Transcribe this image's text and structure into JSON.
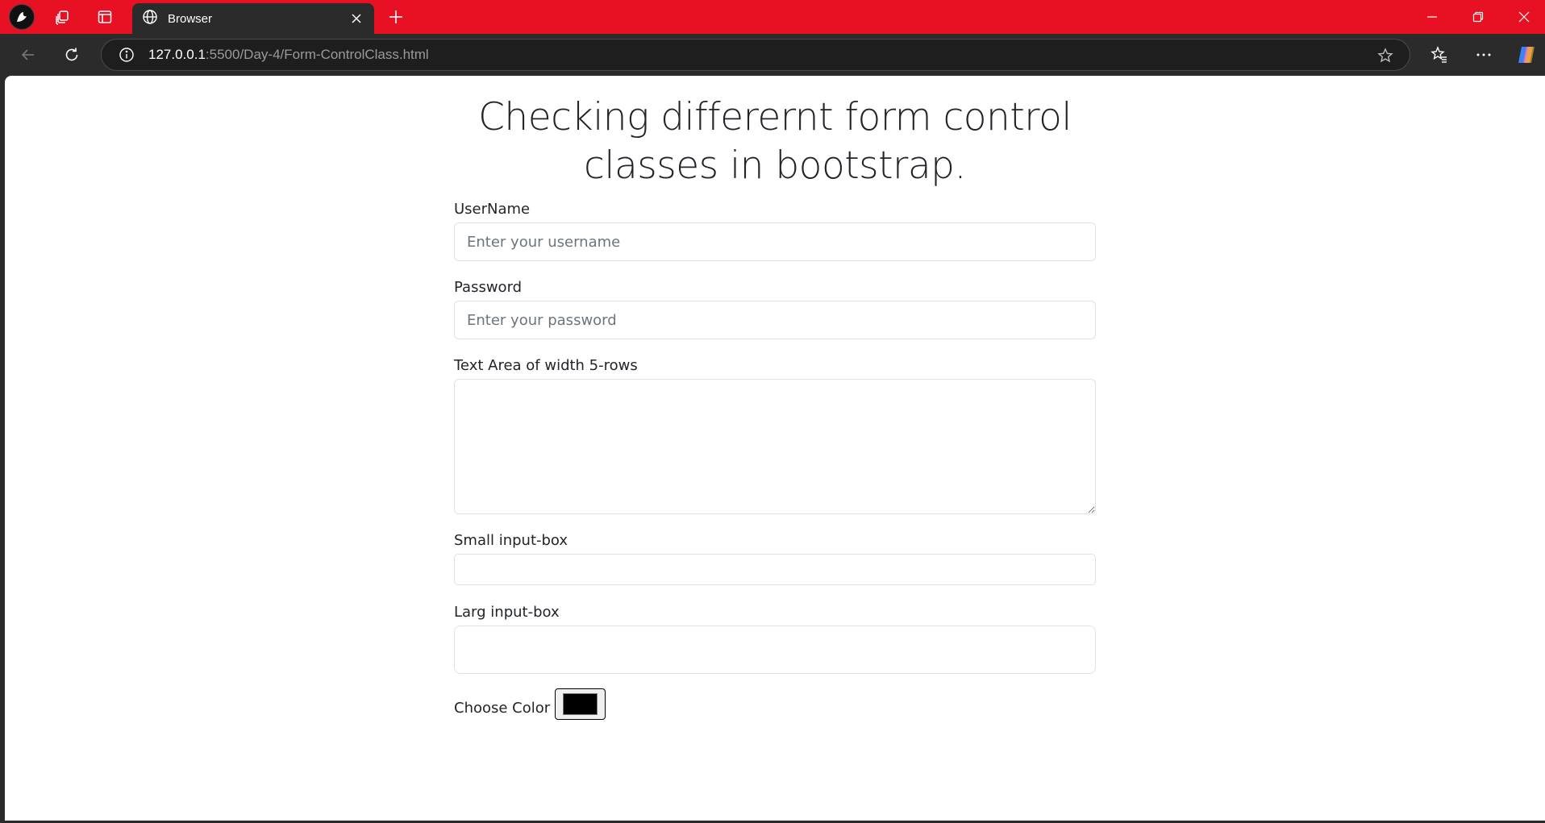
{
  "browser": {
    "tab_title": "Browser",
    "url_host": "127.0.0.1",
    "url_rest": ":5500/Day-4/Form-ControlClass.html"
  },
  "page": {
    "heading": "Checking differernt form control classes in bootstrap.",
    "username": {
      "label": "UserName",
      "placeholder": "Enter your username"
    },
    "password": {
      "label": "Password",
      "placeholder": "Enter your password"
    },
    "textarea": {
      "label": "Text Area of width 5-rows"
    },
    "small": {
      "label": "Small input-box"
    },
    "large": {
      "label": "Larg input-box"
    },
    "color": {
      "label": "Choose Color",
      "value": "#000000"
    }
  },
  "colors": {
    "titlebar": "#e81123",
    "chrome": "#2b2b2b",
    "text": "#212529"
  },
  "icons": [
    "profile-icon",
    "workspaces-icon",
    "tab-actions-icon",
    "globe-icon",
    "close-icon",
    "plus-icon",
    "minimize-icon",
    "restore-icon",
    "back-icon",
    "refresh-icon",
    "info-icon",
    "star-icon",
    "favorites-icon",
    "more-icon",
    "copilot-icon"
  ]
}
